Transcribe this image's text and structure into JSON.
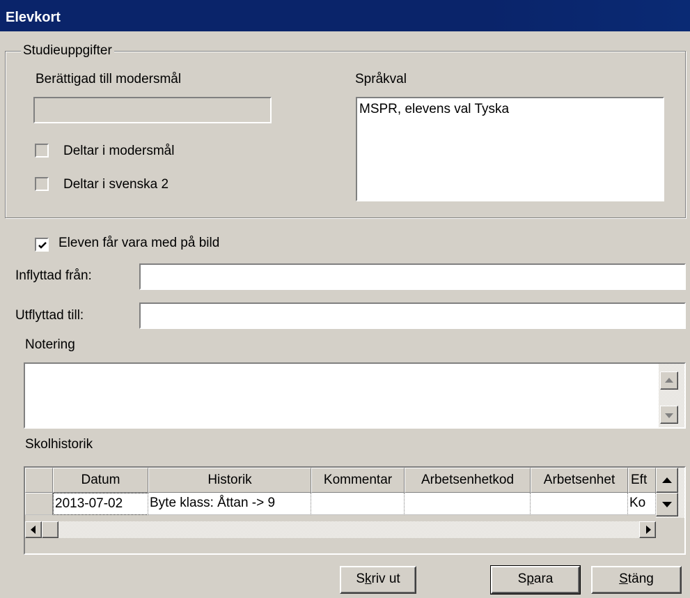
{
  "window": {
    "title": "Elevkort"
  },
  "studie": {
    "legend": "Studieuppgifter",
    "berattigad_label": "Berättigad till modersmål",
    "berattigad_value": "",
    "sprakval_label": "Språkval",
    "sprakval_value": "MSPR, elevens val Tyska",
    "deltar_modersmal": {
      "label": "Deltar i modersmål",
      "checked": false
    },
    "deltar_svenska2": {
      "label": "Deltar i svenska 2",
      "checked": false
    }
  },
  "bild": {
    "label": "Eleven får vara med på bild",
    "checked": true
  },
  "inflyttad": {
    "label": "Inflyttad från:",
    "value": ""
  },
  "utflyttad": {
    "label": "Utflyttad till:",
    "value": ""
  },
  "notering": {
    "label": "Notering",
    "value": ""
  },
  "skolhistorik": {
    "label": "Skolhistorik",
    "columns": [
      "",
      "Datum",
      "Historik",
      "Kommentar",
      "Arbetsenhetkod",
      "Arbetsenhet",
      "Eft"
    ],
    "rows": [
      [
        "",
        "2013-07-02",
        "Byte klass: Åttan -> 9",
        "",
        "",
        "",
        "Ko"
      ]
    ]
  },
  "buttons": {
    "skriv_ut": {
      "pre": "S",
      "key": "k",
      "post": "riv ut"
    },
    "spara": {
      "pre": "S",
      "key": "p",
      "post": "ara"
    },
    "stang": {
      "pre": "",
      "key": "S",
      "post": "täng"
    }
  },
  "icons": {
    "scroll_up": "arrow-up-icon",
    "scroll_down": "arrow-down-icon",
    "scroll_left": "arrow-left-icon",
    "scroll_right": "arrow-right-icon",
    "checkmark": "checkmark-icon"
  },
  "colors": {
    "titlebar": "#0a246a",
    "face": "#d4d0c8"
  }
}
